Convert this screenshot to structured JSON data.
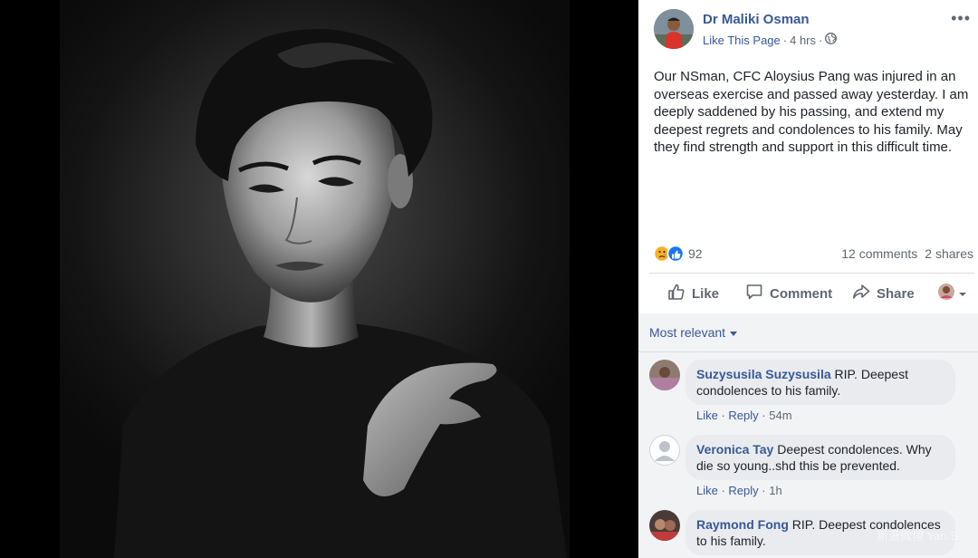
{
  "post": {
    "author": "Dr Maliki Osman",
    "like_page_label": "Like This Page",
    "separator": "·",
    "time": "4 hrs",
    "more_label": "•••",
    "text": "Our NSman, CFC Aloysius Pang was injured in an overseas exercise and passed away yesterday. I am deeply saddened by his passing, and extend my deepest regrets and condolences to his family. May they find strength and support in this difficult time."
  },
  "stats": {
    "reactions_count": "92",
    "comments_count": "12 comments",
    "shares_count": "2 shares"
  },
  "actions": {
    "like_label": "Like",
    "comment_label": "Comment",
    "share_label": "Share"
  },
  "comments_section": {
    "sort_label": "Most relevant"
  },
  "comments": [
    {
      "name": "Suzysusila Suzysusila",
      "text_line1": "RIP. Deepest",
      "text_line2": "condolences to his family.",
      "like": "Like",
      "reply": "Reply",
      "time": "54m"
    },
    {
      "name": "Veronica Tay",
      "text_line1": "Deepest condolences. Why",
      "text_line2": "die so young..shd this be prevented.",
      "like": "Like",
      "reply": "Reply",
      "time": "1h"
    },
    {
      "name": "Raymond Fong",
      "text_line1": "RIP. Deepest condolences",
      "text_line2": "to his family."
    }
  ],
  "watermark": "新浪微博 Yan.S",
  "colors": {
    "link_blue": "#385898",
    "text": "#1d2129",
    "muted": "#606770",
    "bubble": "#e9ebee",
    "comments_bg": "#f2f3f5",
    "like_blue": "#1877f2"
  }
}
